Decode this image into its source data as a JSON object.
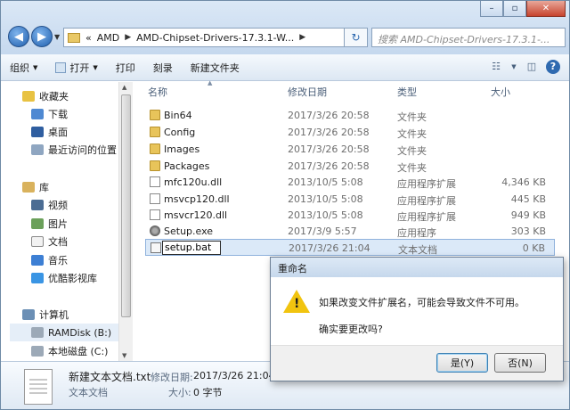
{
  "window": {
    "minimize": "–",
    "maximize": "▫",
    "close": "✕"
  },
  "address": {
    "crumbs": [
      "«",
      "AMD",
      "AMD-Chipset-Drivers-17.3.1-W..."
    ],
    "search_placeholder": "搜索 AMD-Chipset-Drivers-17.3.1-..."
  },
  "toolbar": {
    "organize": "组织",
    "open": "打开",
    "print": "打印",
    "burn": "刻录",
    "new_folder": "新建文件夹"
  },
  "nav": {
    "favorites": "收藏夹",
    "downloads": "下载",
    "desktop": "桌面",
    "recent": "最近访问的位置",
    "libraries": "库",
    "videos": "视频",
    "pictures": "图片",
    "documents": "文档",
    "music": "音乐",
    "youku": "优酷影视库",
    "computer": "计算机",
    "ramdisk": "RAMDisk (B:)",
    "local_disk": "本地磁盘 (C:)"
  },
  "columns": {
    "name": "名称",
    "date": "修改日期",
    "type": "类型",
    "size": "大小"
  },
  "files": [
    {
      "name": "Bin64",
      "date": "2017/3/26 20:58",
      "type": "文件夹",
      "size": "",
      "icon": "folder-icon"
    },
    {
      "name": "Config",
      "date": "2017/3/26 20:58",
      "type": "文件夹",
      "size": "",
      "icon": "folder-icon"
    },
    {
      "name": "Images",
      "date": "2017/3/26 20:58",
      "type": "文件夹",
      "size": "",
      "icon": "folder-icon"
    },
    {
      "name": "Packages",
      "date": "2017/3/26 20:58",
      "type": "文件夹",
      "size": "",
      "icon": "folder-icon"
    },
    {
      "name": "mfc120u.dll",
      "date": "2013/10/5 5:08",
      "type": "应用程序扩展",
      "size": "4,346 KB",
      "icon": "dll-icon"
    },
    {
      "name": "msvcp120.dll",
      "date": "2013/10/5 5:08",
      "type": "应用程序扩展",
      "size": "445 KB",
      "icon": "dll-icon"
    },
    {
      "name": "msvcr120.dll",
      "date": "2013/10/5 5:08",
      "type": "应用程序扩展",
      "size": "949 KB",
      "icon": "dll-icon"
    },
    {
      "name": "Setup.exe",
      "date": "2017/3/9 5:57",
      "type": "应用程序",
      "size": "303 KB",
      "icon": "exe-icon"
    },
    {
      "name": "setup.bat",
      "date": "2017/3/26 21:04",
      "type": "文本文档",
      "size": "0 KB",
      "icon": "bat-icon"
    }
  ],
  "details": {
    "filename": "新建文本文档.txt",
    "modified_label": "修改日期:",
    "modified_value": "2017/3/26 21:04",
    "type": "文本文档",
    "size_label": "大小:",
    "size_value": "0 字节"
  },
  "dialog": {
    "title": "重命名",
    "message": "如果改变文件扩展名，可能会导致文件不可用。",
    "question": "确实要更改吗?",
    "yes": "是(Y)",
    "no": "否(N)"
  }
}
